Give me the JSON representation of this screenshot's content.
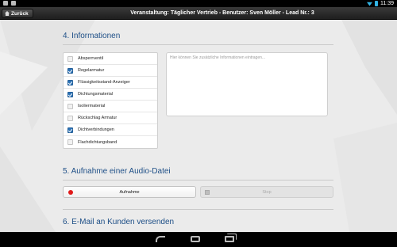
{
  "statusbar": {
    "time": "11:39"
  },
  "topbar": {
    "back_label": "Zurück",
    "title": "Veranstaltung: Täglicher Vertrieb - Benutzer: Sven Möller - Lead Nr.: 3"
  },
  "section_info": {
    "title": "4. Informationen",
    "checkboxes": [
      {
        "label": "Absperrventil",
        "checked": false
      },
      {
        "label": "Regelarmatur",
        "checked": true
      },
      {
        "label": "Flüssigkeitsstand-Anzeiger",
        "checked": true
      },
      {
        "label": "Dichtungsmaterial",
        "checked": true
      },
      {
        "label": "Isoliermaterial",
        "checked": false
      },
      {
        "label": "Rückschlag Armatur",
        "checked": false
      },
      {
        "label": "Dichtverbindungen",
        "checked": true
      },
      {
        "label": "Flachdichtungsband",
        "checked": false
      }
    ],
    "notes_placeholder": "Hier können Sie zusätzliche Informationen eintragen..."
  },
  "section_audio": {
    "title": "5. Aufnahme einer Audio-Datei",
    "record_label": "Aufnahme",
    "stop_label": "Stop"
  },
  "section_email": {
    "title": "6. E-Mail an Kunden versenden"
  },
  "colors": {
    "accent": "#1e4f87",
    "check": "#2c73b8",
    "record": "#e01a1a",
    "system_blue": "#33b5e5"
  }
}
